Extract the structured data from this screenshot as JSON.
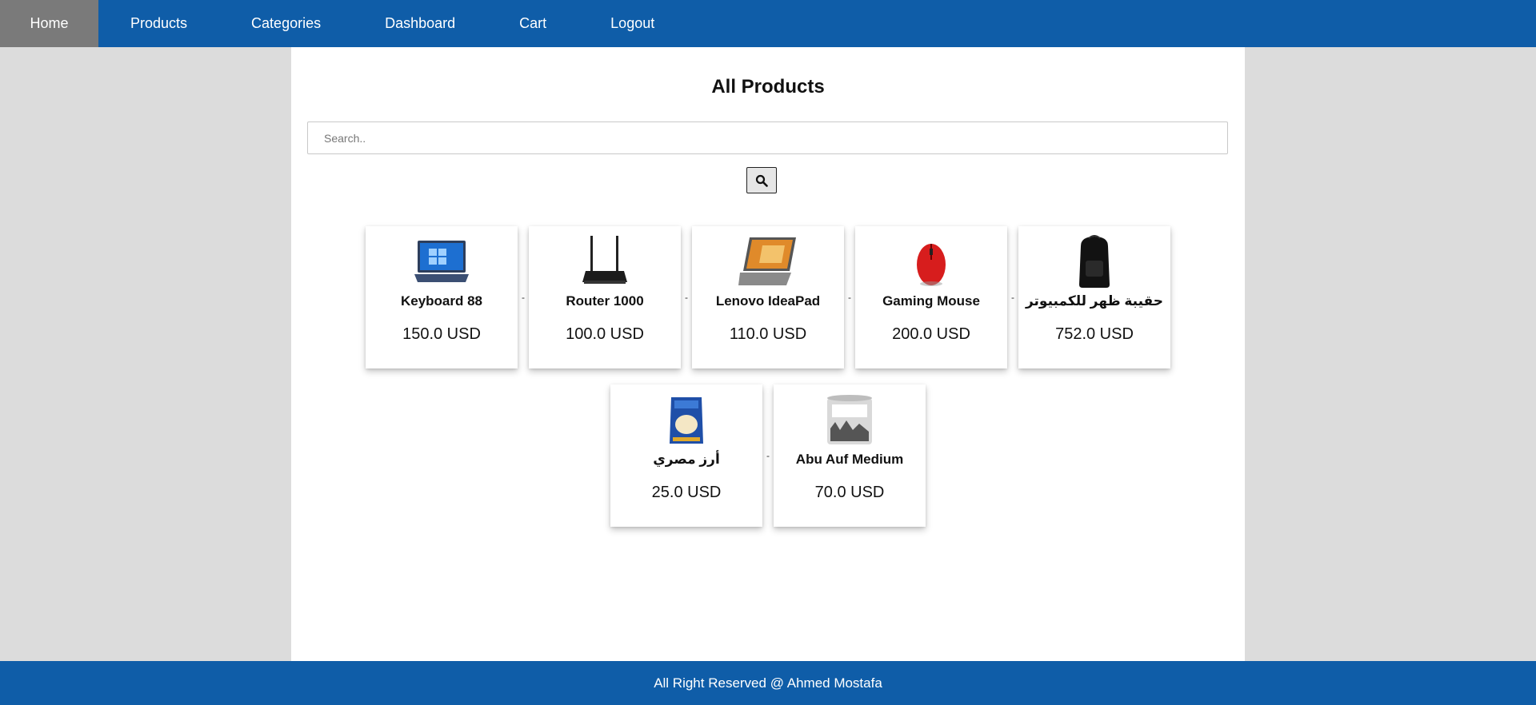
{
  "nav": {
    "items": [
      {
        "label": "Home",
        "active": true
      },
      {
        "label": "Products"
      },
      {
        "label": "Categories"
      },
      {
        "label": "Dashboard"
      },
      {
        "label": "Cart"
      },
      {
        "label": "Logout"
      }
    ]
  },
  "main": {
    "title": "All Products",
    "search": {
      "placeholder": "Search..",
      "value": "",
      "icon": "search-icon"
    },
    "separator": "-",
    "products": [
      {
        "name": "Keyboard 88",
        "price": "150.0 USD",
        "image": "laptop-image"
      },
      {
        "name": "Router 1000",
        "price": "100.0 USD",
        "image": "router-image"
      },
      {
        "name": "Lenovo IdeaPad",
        "price": "110.0 USD",
        "image": "laptop-image"
      },
      {
        "name": "Gaming Mouse",
        "price": "200.0 USD",
        "image": "mouse-image"
      },
      {
        "name": "حقيبة ظهر للكمبيوتر",
        "price": "752.0 USD",
        "image": "backpack-image"
      },
      {
        "name": "أرز مصري",
        "price": "25.0 USD",
        "image": "rice-bag-image"
      },
      {
        "name": "Abu Auf Medium",
        "price": "70.0 USD",
        "image": "coffee-can-image"
      }
    ]
  },
  "footer": {
    "text": "All Right Reserved @ Ahmed Mostafa"
  },
  "colors": {
    "brand": "#0f5da8",
    "active_nav": "#7a7a7a",
    "page_bg": "#dcdcdc"
  }
}
